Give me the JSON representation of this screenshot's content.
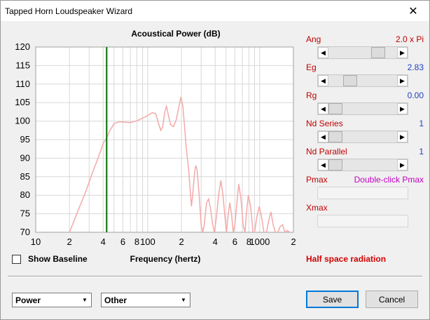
{
  "window": {
    "title": "Tapped Horn Loudspeaker Wizard",
    "close_glyph": "✕"
  },
  "chart_data": {
    "type": "line",
    "title": "Acoustical Power (dB)",
    "xlabel": "Frequency (hertz)",
    "ylabel": "",
    "xscale": "log",
    "xlim": [
      10,
      2000
    ],
    "ylim": [
      70,
      120
    ],
    "yticks": [
      70,
      75,
      80,
      85,
      90,
      95,
      100,
      105,
      110,
      115,
      120
    ],
    "xtick_labels": [
      {
        "f": 10,
        "label": "10"
      },
      {
        "f": 20,
        "label": "2"
      },
      {
        "f": 40,
        "label": "4"
      },
      {
        "f": 60,
        "label": "6"
      },
      {
        "f": 80,
        "label": "8"
      },
      {
        "f": 100,
        "label": "100"
      },
      {
        "f": 200,
        "label": "2"
      },
      {
        "f": 400,
        "label": "4"
      },
      {
        "f": 600,
        "label": "6"
      },
      {
        "f": 800,
        "label": "8"
      },
      {
        "f": 1000,
        "label": "1000"
      },
      {
        "f": 2000,
        "label": "2"
      }
    ],
    "grid": true,
    "marker_line": {
      "f": 43,
      "color": "#007000"
    },
    "series": [
      {
        "color": "#f4a9a9",
        "points": [
          [
            20,
            70
          ],
          [
            24,
            76
          ],
          [
            28,
            81
          ],
          [
            32,
            86
          ],
          [
            36,
            90
          ],
          [
            40,
            94
          ],
          [
            43,
            95.5
          ],
          [
            46,
            97.5
          ],
          [
            50,
            99.3
          ],
          [
            55,
            99.8
          ],
          [
            60,
            99.8
          ],
          [
            70,
            99.6
          ],
          [
            80,
            100.1
          ],
          [
            90,
            100.8
          ],
          [
            100,
            101.5
          ],
          [
            110,
            102.3
          ],
          [
            118,
            102.0
          ],
          [
            126,
            99.0
          ],
          [
            131,
            97.5
          ],
          [
            136,
            98.5
          ],
          [
            142,
            102.5
          ],
          [
            147,
            104.0
          ],
          [
            152,
            102.0
          ],
          [
            160,
            99.0
          ],
          [
            170,
            98.5
          ],
          [
            180,
            100.5
          ],
          [
            190,
            104.0
          ],
          [
            198,
            106.5
          ],
          [
            206,
            104.0
          ],
          [
            214,
            98.0
          ],
          [
            222,
            92.0
          ],
          [
            232,
            87.0
          ],
          [
            240,
            81.0
          ],
          [
            246,
            77.0
          ],
          [
            252,
            80.0
          ],
          [
            260,
            85.0
          ],
          [
            268,
            88.0
          ],
          [
            276,
            87.0
          ],
          [
            288,
            80.0
          ],
          [
            300,
            72.0
          ],
          [
            310,
            70.0
          ],
          [
            320,
            72.0
          ],
          [
            335,
            78.0
          ],
          [
            350,
            79.0
          ],
          [
            365,
            76.0
          ],
          [
            380,
            72.0
          ],
          [
            395,
            70.0
          ],
          [
            410,
            74.0
          ],
          [
            430,
            80.0
          ],
          [
            450,
            84.0
          ],
          [
            470,
            80.0
          ],
          [
            490,
            74.0
          ],
          [
            505,
            70.0
          ],
          [
            520,
            74.0
          ],
          [
            540,
            78.0
          ],
          [
            560,
            75.0
          ],
          [
            580,
            70.0
          ],
          [
            600,
            72.0
          ],
          [
            630,
            79.0
          ],
          [
            650,
            83.0
          ],
          [
            680,
            79.0
          ],
          [
            710,
            72.0
          ],
          [
            740,
            70.0
          ],
          [
            760,
            75.0
          ],
          [
            790,
            80.0
          ],
          [
            830,
            77.0
          ],
          [
            870,
            70.0
          ],
          [
            900,
            70.0
          ],
          [
            940,
            74.0
          ],
          [
            990,
            77.0
          ],
          [
            1040,
            74.0
          ],
          [
            1090,
            70.0
          ],
          [
            1150,
            70.0
          ],
          [
            1200,
            73.0
          ],
          [
            1260,
            75.5
          ],
          [
            1320,
            72.0
          ],
          [
            1380,
            70.0
          ],
          [
            1450,
            70.0
          ],
          [
            1520,
            71.5
          ],
          [
            1600,
            72.0
          ],
          [
            1680,
            70.0
          ],
          [
            1760,
            70.5
          ],
          [
            1850,
            70.0
          ]
        ]
      }
    ]
  },
  "show_baseline": {
    "label": "Show Baseline",
    "checked": false
  },
  "params": [
    {
      "name": "Ang",
      "value": "2.0 x Pi",
      "name_color": "#c00000",
      "value_color": "#c00000",
      "thumb": 0.78,
      "enabled": true
    },
    {
      "name": "Eg",
      "value": "2.83",
      "name_color": "#c00000",
      "value_color": "#2040c0",
      "thumb": 0.27,
      "enabled": true
    },
    {
      "name": "Rg",
      "value": "0.00",
      "name_color": "#c00000",
      "value_color": "#2040c0",
      "thumb": 0.0,
      "enabled": true
    },
    {
      "name": "Nd  Series",
      "value": "1",
      "name_color": "#c00000",
      "value_color": "#2040c0",
      "thumb": 0.0,
      "enabled": true
    },
    {
      "name": "Nd  Parallel",
      "value": "1",
      "name_color": "#c00000",
      "value_color": "#2040c0",
      "thumb": 0.0,
      "enabled": true
    },
    {
      "name": "Pmax",
      "value": "Double-click Pmax",
      "name_color": "#c00000",
      "value_color": "#c000c0",
      "thumb": null,
      "enabled": false
    },
    {
      "name": "Xmax",
      "value": "",
      "name_color": "#c00000",
      "value_color": "#c00000",
      "thumb": null,
      "enabled": false
    }
  ],
  "radiation_note": "Half space radiation",
  "dropdowns": {
    "mode": "Power",
    "category": "Other"
  },
  "buttons": {
    "save": "Save",
    "cancel": "Cancel"
  }
}
